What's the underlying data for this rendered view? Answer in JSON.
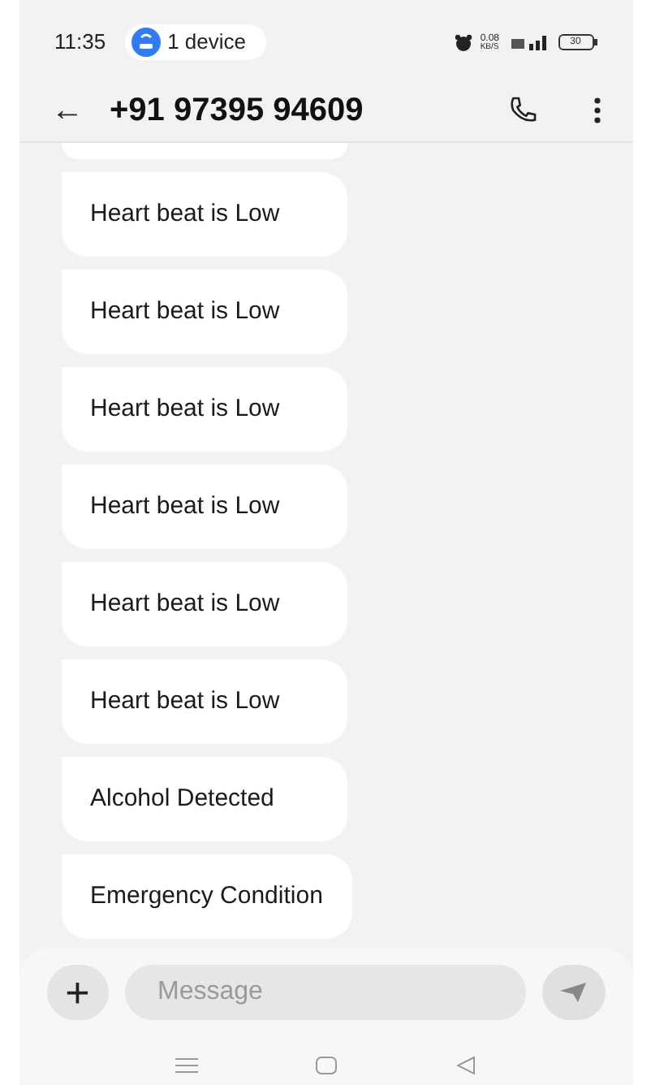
{
  "status_bar": {
    "time": "11:35",
    "device_chip": "1 device",
    "speed": "0.08",
    "speed_unit": "KB/S",
    "battery": "30"
  },
  "header": {
    "back": "←",
    "title": "+91 97395 94609"
  },
  "messages": [
    {
      "text": "Heart beat is Low"
    },
    {
      "text": "Heart beat is Low"
    },
    {
      "text": "Heart beat is Low"
    },
    {
      "text": "Heart beat is Low"
    },
    {
      "text": "Heart beat is Low"
    },
    {
      "text": "Heart beat is Low"
    },
    {
      "text": "Alcohol Detected"
    },
    {
      "text": "Emergency Condition"
    }
  ],
  "composer": {
    "add": "+",
    "placeholder": "Message"
  }
}
